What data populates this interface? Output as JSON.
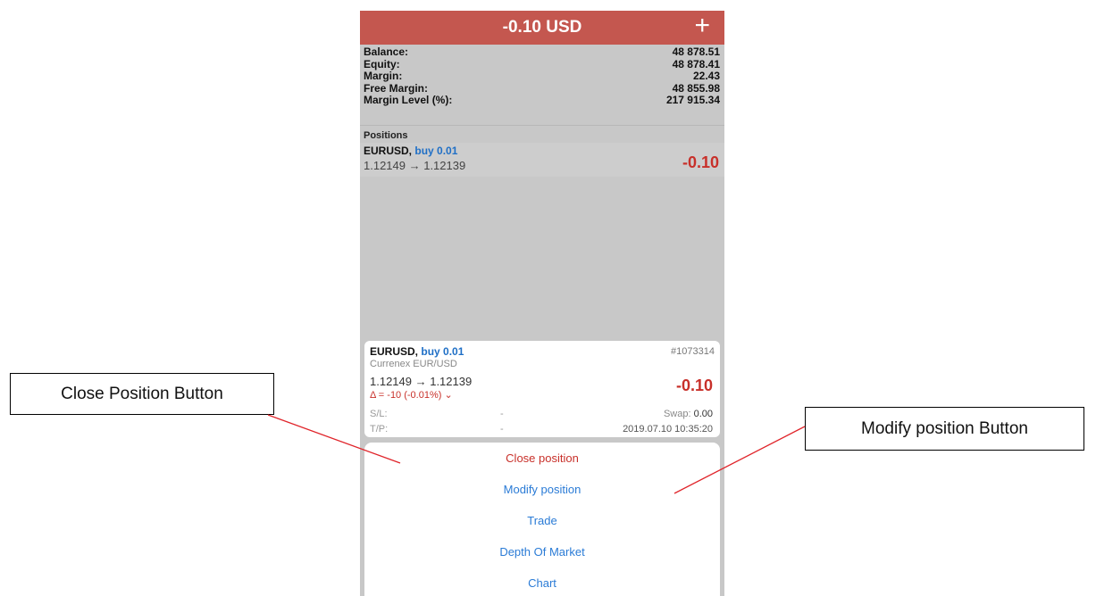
{
  "header": {
    "total": "-0.10 USD",
    "add_icon": "plus-icon",
    "color": "#c4574f"
  },
  "account": [
    {
      "label": "Balance:",
      "value": "48 878.51"
    },
    {
      "label": "Equity:",
      "value": "48 878.41"
    },
    {
      "label": "Margin:",
      "value": "22.43"
    },
    {
      "label": "Free Margin:",
      "value": "48 855.98"
    },
    {
      "label": "Margin Level (%):",
      "value": "217 915.34"
    }
  ],
  "positions": {
    "header": "Positions",
    "items": [
      {
        "symbol": "EURUSD,",
        "side": "buy 0.01",
        "prices": "1.12149 → 1.12139",
        "profit": "-0.10"
      }
    ]
  },
  "detail": {
    "symbol": "EURUSD,",
    "side": "buy 0.01",
    "ticket": "#1073314",
    "description": "Currenex EUR/USD",
    "prices": "1.12149 → 1.12139",
    "delta": "Δ = -10 (-0.01%) ⌄",
    "profit": "-0.10",
    "sl_label": "S/L:",
    "sl_value": "-",
    "swap_label": "Swap:",
    "swap_value": "0.00",
    "tp_label": "T/P:",
    "tp_value": "-",
    "time": "2019.07.10 10:35:20"
  },
  "actions": [
    "Close position",
    "Modify position",
    "Trade",
    "Depth Of Market",
    "Chart"
  ],
  "callouts": {
    "close": "Close Position Button",
    "modify": "Modify position Button"
  },
  "colors": {
    "loss": "#c8302a",
    "link": "#2a7bd6",
    "callout_line": "#e0242a"
  }
}
